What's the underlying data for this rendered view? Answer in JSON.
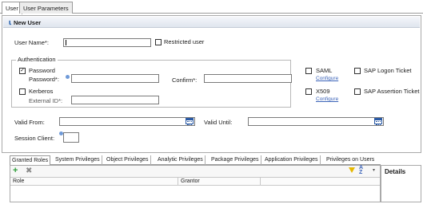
{
  "top_tabs": {
    "user": "User",
    "user_parameters": "User Parameters"
  },
  "section": {
    "title": "New User",
    "icon": "user-icon"
  },
  "user_name": {
    "label": "User Name*:",
    "value": ""
  },
  "restricted_user": {
    "label": "Restricted user",
    "checked": false
  },
  "authentication": {
    "title": "Authentication",
    "password": {
      "label": "Password",
      "checked": true
    },
    "password_field": {
      "label": "Password*:",
      "value": ""
    },
    "confirm_field": {
      "label": "Confirm*:",
      "value": ""
    },
    "kerberos": {
      "label": "Kerberos",
      "checked": false
    },
    "external_id": {
      "label": "External ID*:",
      "value": ""
    }
  },
  "saml": {
    "label": "SAML",
    "configure": "Configure",
    "checked": false
  },
  "x509": {
    "label": "X509",
    "configure": "Configure",
    "checked": false
  },
  "sap_logon_ticket": {
    "label": "SAP Logon Ticket",
    "checked": false
  },
  "sap_assertion_ticket": {
    "label": "SAP Assertion Ticket",
    "checked": false
  },
  "valid_from": {
    "label": "Valid From:",
    "value": ""
  },
  "valid_until": {
    "label": "Valid Until:",
    "value": ""
  },
  "session_client": {
    "label": "Session Client:",
    "value": ""
  },
  "bottom_tabs": [
    "Granted Roles",
    "System Privileges",
    "Object Privileges",
    "Analytic Privileges",
    "Package Privileges",
    "Application Privileges",
    "Privileges on Users"
  ],
  "grid": {
    "columns": [
      "Role",
      "Grantor"
    ],
    "toolbar_icons": [
      "add-icon",
      "delete-icon",
      "filter-icon",
      "sort-icon",
      "dropdown-icon"
    ]
  },
  "details": {
    "title": "Details"
  },
  "colors": {
    "link": "#3b63b8",
    "add_icon": "#2e9e3a",
    "filter_icon": "#e6b800",
    "accent": "#3a6fb5"
  }
}
